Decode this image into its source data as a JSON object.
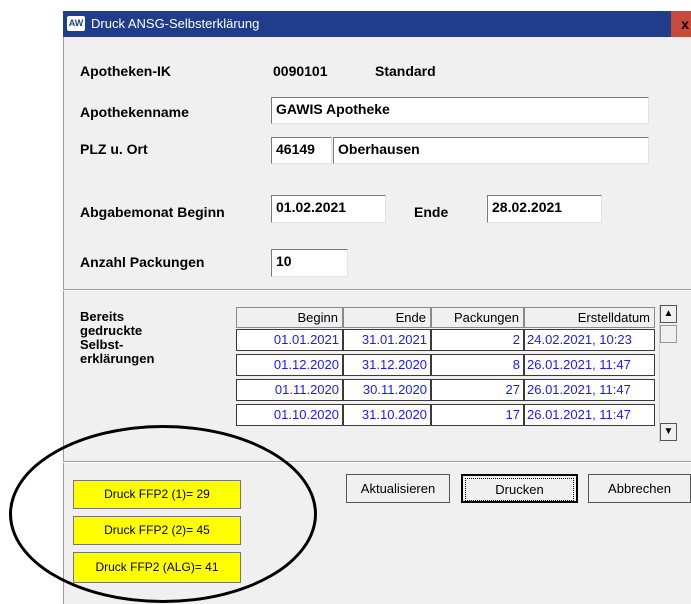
{
  "window": {
    "title": "Druck ANSG-Selbsterklärung",
    "icon": "app-logo-icon",
    "close": "x"
  },
  "form": {
    "ik_label": "Apotheken-IK",
    "ik_value": "0090101",
    "ik_type": "Standard",
    "name_label": "Apothekenname",
    "name_value": "GAWIS Apotheke",
    "plz_label": "PLZ u. Ort",
    "plz_value": "46149",
    "ort_value": "Oberhausen",
    "month_label": "Abgabemonat Beginn",
    "begin_value": "01.02.2021",
    "end_label": "Ende",
    "end_value": "28.02.2021",
    "count_label": "Anzahl Packungen",
    "count_value": "10"
  },
  "printed": {
    "label_lines": [
      "Bereits",
      "gedruckte",
      "Selbst-",
      "erklärungen"
    ],
    "columns": [
      "Beginn",
      "Ende",
      "Packungen",
      "Erstelldatum"
    ],
    "rows": [
      [
        "01.01.2021",
        "31.01.2021",
        "2",
        "24.02.2021, 10:23"
      ],
      [
        "01.12.2020",
        "31.12.2020",
        "8",
        "26.01.2021, 11:47"
      ],
      [
        "01.11.2020",
        "30.11.2020",
        "27",
        "26.01.2021, 11:47"
      ],
      [
        "01.10.2020",
        "31.10.2020",
        "17",
        "26.01.2021, 11:47"
      ]
    ]
  },
  "buttons": {
    "ffp2_1": "Druck FFP2 (1)= 29",
    "ffp2_2": "Druck FFP2 (2)= 45",
    "ffp2_alg": "Druck FFP2 (ALG)= 41",
    "refresh": "Aktualisieren",
    "print": "Drucken",
    "cancel": "Abbrechen"
  },
  "colors": {
    "titlebar": "#1f3d8a",
    "yellow_button": "#ffff00",
    "table_text": "#1a1aff"
  }
}
